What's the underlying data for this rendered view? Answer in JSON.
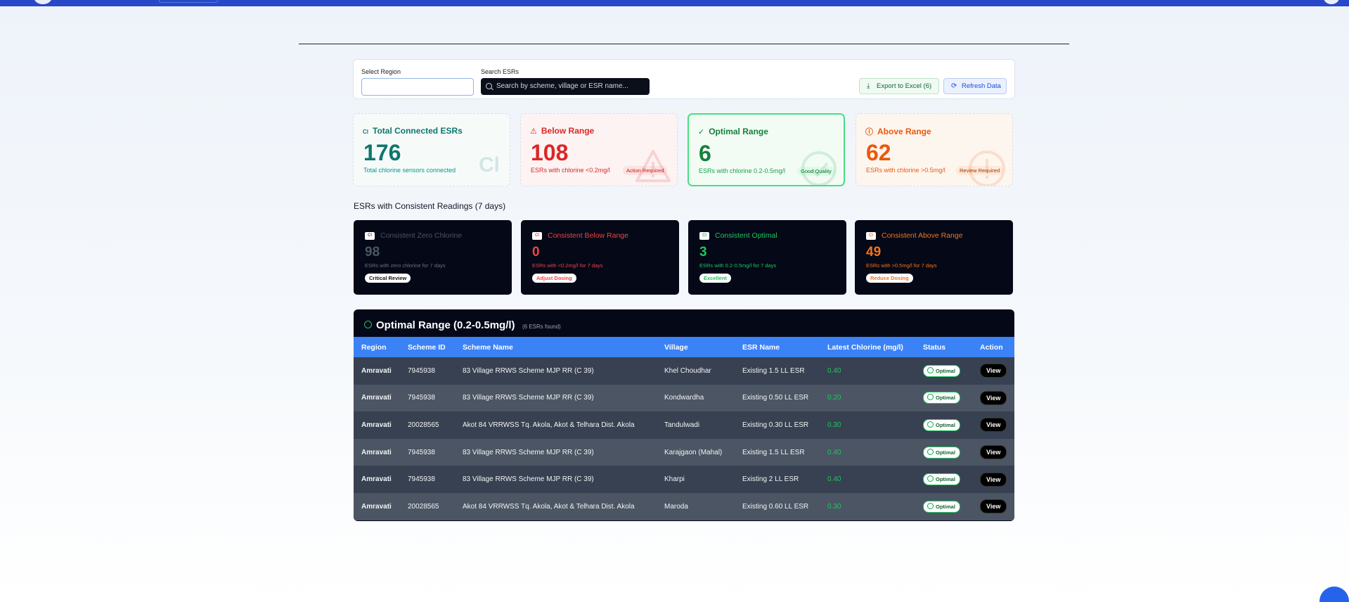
{
  "filters": {
    "region_label": "Select Region",
    "region_value": "",
    "search_label": "Search ESRs",
    "search_placeholder": "Search by scheme, village or ESR name...",
    "export_label": "Export to Excel (6)",
    "refresh_label": "Refresh Data"
  },
  "summary": {
    "total": {
      "icon": "Cl",
      "title": "Total Connected ESRs",
      "value": "176",
      "desc": "Total chlorine sensors connected",
      "watermark": "Cl"
    },
    "below": {
      "title": "Below Range",
      "value": "108",
      "desc": "ESRs with chlorine <0.2mg/l",
      "tag": "Action Required"
    },
    "optimal": {
      "title": "Optimal Range",
      "value": "6",
      "desc": "ESRs with chlorine 0.2-0.5mg/l",
      "tag": "Good Quality"
    },
    "above": {
      "title": "Above Range",
      "value": "62",
      "desc": "ESRs with chlorine >0.5mg/l",
      "tag": "Review Required"
    }
  },
  "consistent": {
    "title": "ESRs with Consistent Readings (7 days)",
    "cards": [
      {
        "badge": "Cl",
        "title": "Consistent Zero Chlorine",
        "value": "98",
        "desc": "ESRs with zero chlorine for 7 days",
        "tag": "Critical Review"
      },
      {
        "badge": "Cl",
        "title": "Consistent Below Range",
        "value": "0",
        "desc": "ESRs with <0.2mg/l for 7 days",
        "tag": "Adjust Dosing"
      },
      {
        "badge": "Cl",
        "title": "Consistent Optimal",
        "value": "3",
        "desc": "ESRs with 0.2-0.5mg/l for 7 days",
        "tag": "Excellent"
      },
      {
        "badge": "Cl",
        "title": "Consistent Above Range",
        "value": "49",
        "desc": "ESRs with >0.5mg/l for 7 days",
        "tag": "Reduce Dosing"
      }
    ]
  },
  "table": {
    "title": "Optimal Range (0.2-0.5mg/l)",
    "count": "(6 ESRs found)",
    "headers": [
      "Region",
      "Scheme ID",
      "Scheme Name",
      "Village",
      "ESR Name",
      "Latest Chlorine (mg/l)",
      "Status",
      "Action"
    ],
    "rows": [
      {
        "region": "Amravati",
        "scheme_id": "7945938",
        "scheme_name": "83 Village RRWS Scheme MJP RR (C 39)",
        "village": "Khel Choudhar",
        "esr": "Existing 1.5 LL ESR",
        "chlorine": "0.40",
        "status": "Optimal",
        "action": "View"
      },
      {
        "region": "Amravati",
        "scheme_id": "7945938",
        "scheme_name": "83 Village RRWS Scheme MJP RR (C 39)",
        "village": "Kondwardha",
        "esr": "Existing 0.50 LL ESR",
        "chlorine": "0.20",
        "status": "Optimal",
        "action": "View"
      },
      {
        "region": "Amravati",
        "scheme_id": "20028565",
        "scheme_name": "Akot 84 VRRWSS Tq. Akola, Akot & Telhara Dist. Akola",
        "village": "Tandulwadi",
        "esr": "Existing 0.30 LL ESR",
        "chlorine": "0.30",
        "status": "Optimal",
        "action": "View"
      },
      {
        "region": "Amravati",
        "scheme_id": "7945938",
        "scheme_name": "83 Village RRWS Scheme MJP RR (C 39)",
        "village": "Karajgaon (Mahal)",
        "esr": "Existing 1.5 LL ESR",
        "chlorine": "0.40",
        "status": "Optimal",
        "action": "View"
      },
      {
        "region": "Amravati",
        "scheme_id": "7945938",
        "scheme_name": "83 Village RRWS Scheme MJP RR (C 39)",
        "village": "Kharpi",
        "esr": "Existing 2 LL ESR",
        "chlorine": "0.40",
        "status": "Optimal",
        "action": "View"
      },
      {
        "region": "Amravati",
        "scheme_id": "20028565",
        "scheme_name": "Akot 84 VRRWSS Tq. Akola, Akot & Telhara Dist. Akola",
        "village": "Maroda",
        "esr": "Existing 0.60 LL ESR",
        "chlorine": "0.30",
        "status": "Optimal",
        "action": "View"
      }
    ]
  },
  "colors": {
    "primary": "#2748c9",
    "optimal": "#22c55e",
    "below": "#dc2626",
    "above": "#ea580c",
    "table_header": "#3b82f6"
  }
}
